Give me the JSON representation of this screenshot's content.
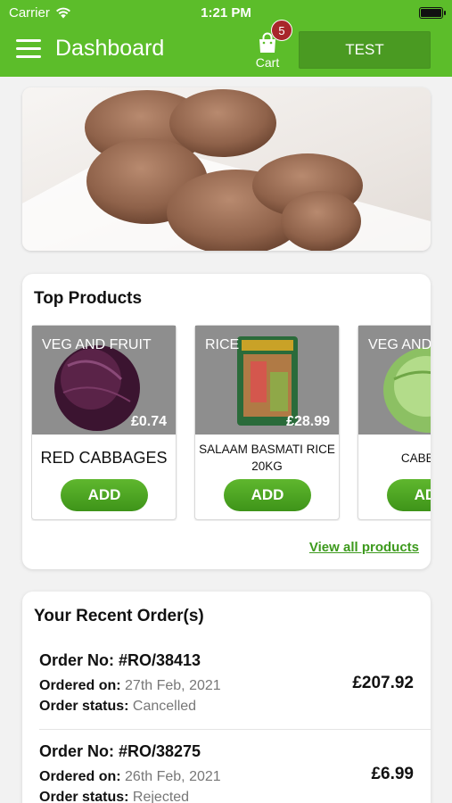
{
  "status_bar": {
    "carrier": "Carrier",
    "time": "1:21 PM"
  },
  "header": {
    "title": "Dashboard",
    "cart_label": "Cart",
    "cart_count": "5",
    "test_button": "TEST",
    "accent_color": "#5cbd2a"
  },
  "top_products": {
    "title": "Top Products",
    "view_all": "View all products",
    "items": [
      {
        "category": "VEG AND FRUIT",
        "price": "£0.74",
        "name": "RED CABBAGES",
        "add": "ADD",
        "image": "red-cabbage"
      },
      {
        "category": "RICE",
        "price": "£28.99",
        "name": "SALAAM BASMATI RICE 20KG",
        "add": "ADD",
        "image": "rice-bag"
      },
      {
        "category": "VEG AND FRUIT",
        "price": "",
        "name": "CABBAGE",
        "add": "ADD",
        "image": "green-cabbage"
      }
    ]
  },
  "recent_orders": {
    "title": "Your Recent Order(s)",
    "ordered_on_label": "Ordered on:",
    "status_label": "Order status:",
    "orders": [
      {
        "number": "Order No: #RO/38413",
        "date": "27th Feb, 2021",
        "status": "Cancelled",
        "total": "£207.92"
      },
      {
        "number": "Order No: #RO/38275",
        "date": "26th Feb, 2021",
        "status": "Rejected",
        "total": "£6.99"
      }
    ]
  }
}
